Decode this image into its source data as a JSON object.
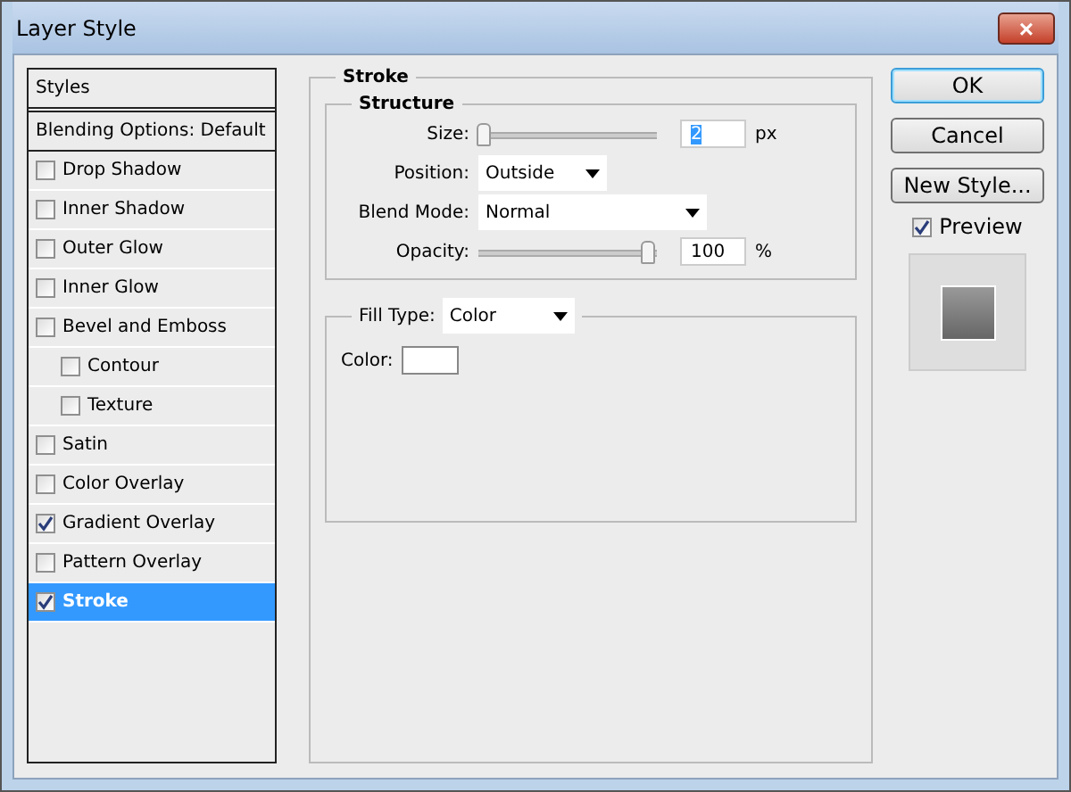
{
  "window": {
    "title": "Layer Style",
    "close": "×"
  },
  "styles": {
    "header": "Styles",
    "items": [
      {
        "label": "Blending Options: Default",
        "kind": "plain",
        "selected": false
      },
      {
        "label": "Drop Shadow",
        "kind": "check",
        "checked": false,
        "selected": false
      },
      {
        "label": "Inner Shadow",
        "kind": "check",
        "checked": false,
        "selected": false
      },
      {
        "label": "Outer Glow",
        "kind": "check",
        "checked": false,
        "selected": false
      },
      {
        "label": "Inner Glow",
        "kind": "check",
        "checked": false,
        "selected": false
      },
      {
        "label": "Bevel and Emboss",
        "kind": "check",
        "checked": false,
        "selected": false,
        "children": [
          {
            "label": "Contour",
            "kind": "check",
            "checked": false,
            "selected": false
          },
          {
            "label": "Texture",
            "kind": "check",
            "checked": false,
            "selected": false
          }
        ]
      },
      {
        "label": "Satin",
        "kind": "check",
        "checked": false,
        "selected": false
      },
      {
        "label": "Color Overlay",
        "kind": "check",
        "checked": false,
        "selected": false
      },
      {
        "label": "Gradient Overlay",
        "kind": "check",
        "checked": true,
        "selected": false
      },
      {
        "label": "Pattern Overlay",
        "kind": "check",
        "checked": false,
        "selected": false
      },
      {
        "label": "Stroke",
        "kind": "check",
        "checked": true,
        "selected": true
      }
    ]
  },
  "stroke": {
    "title": "Stroke",
    "structure": {
      "title": "Structure",
      "size": {
        "label": "Size:",
        "level": 0.0,
        "value": "2",
        "unit": "px"
      },
      "position": {
        "label": "Position:",
        "value": "Outside"
      },
      "blend_mode": {
        "label": "Blend Mode:",
        "value": "Normal"
      },
      "opacity": {
        "label": "Opacity:",
        "level": 1.0,
        "value": "100",
        "unit": "%"
      }
    },
    "fill": {
      "label": "Fill Type:",
      "value": "Color",
      "color_label": "Color:"
    }
  },
  "buttons": [
    {
      "label": "OK",
      "default": true
    },
    {
      "label": "Cancel",
      "default": false
    },
    {
      "label": "New Style...",
      "default": false
    }
  ],
  "preview": {
    "label": "Preview",
    "checked": true
  }
}
